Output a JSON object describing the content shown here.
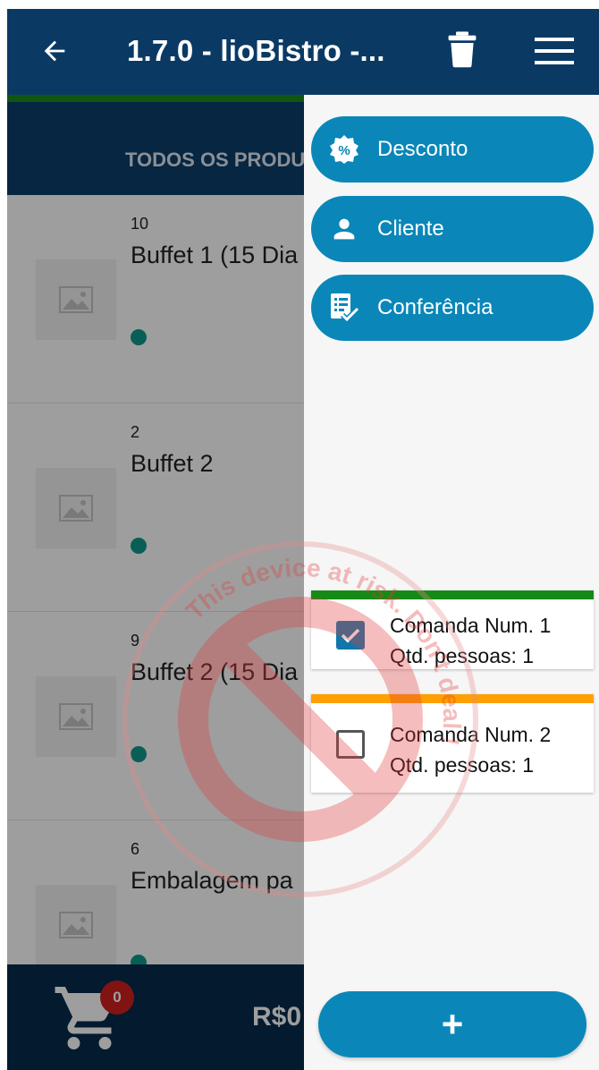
{
  "appbar": {
    "title": "1.7.0 - lioBistro -...",
    "back_icon": "arrow-left-icon",
    "trash_icon": "trash-icon",
    "menu_icon": "hamburger-menu-icon",
    "color": "#0a3a64"
  },
  "tabs": {
    "label": "TODOS OS PRODU"
  },
  "products": [
    {
      "qty": "10",
      "name": "Buffet 1 (15 Dia"
    },
    {
      "qty": "2",
      "name": "Buffet 2"
    },
    {
      "qty": "9",
      "name": "Buffet 2 (15 Dia"
    },
    {
      "qty": "6",
      "name": "Embalagem pa"
    }
  ],
  "cart": {
    "count": "0",
    "total": "R$0"
  },
  "drawer": {
    "actions": [
      {
        "label": "Desconto",
        "icon": "discount-badge-icon"
      },
      {
        "label": "Cliente",
        "icon": "person-icon"
      },
      {
        "label": "Conferência",
        "icon": "checklist-icon"
      }
    ],
    "comandas": [
      {
        "line1": "Comanda Num. 1",
        "line2": "Qtd. pessoas: 1",
        "checked": true,
        "stripe_color": "#168a16"
      },
      {
        "line1": "Comanda Num. 2",
        "line2": "Qtd. pessoas: 1",
        "checked": false,
        "stripe_color": "#ffa000"
      }
    ],
    "fab_label": "+"
  },
  "watermark": {
    "text": "This device at risk. Don't deal !"
  },
  "colors": {
    "accent": "#0a87b8",
    "scrim": "rgba(0,0,0,0.38)",
    "badge": "#d11f1f"
  }
}
